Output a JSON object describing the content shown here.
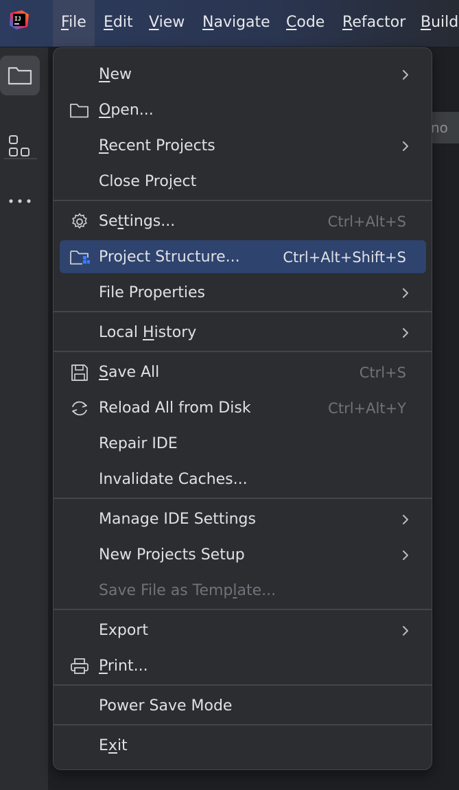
{
  "menubar": {
    "items": [
      {
        "pre": "",
        "u": "F",
        "post": "ile"
      },
      {
        "pre": "",
        "u": "E",
        "post": "dit"
      },
      {
        "pre": "",
        "u": "V",
        "post": "iew"
      },
      {
        "pre": "",
        "u": "N",
        "post": "avigate"
      },
      {
        "pre": "",
        "u": "C",
        "post": "ode"
      },
      {
        "pre": "",
        "u": "R",
        "post": "efactor"
      },
      {
        "pre": "",
        "u": "B",
        "post": "uild"
      }
    ]
  },
  "logo": {
    "text": "IJ"
  },
  "toolstrip": {
    "icons": [
      "project-folder-icon",
      "structure-icon",
      "more-icon"
    ]
  },
  "peek_tab": {
    "text": "no"
  },
  "dropdown": {
    "rows": [
      {
        "pre": "",
        "u": "N",
        "post": "ew",
        "shortcut": "",
        "submenu": true,
        "icon": ""
      },
      {
        "pre": "",
        "u": "O",
        "post": "pen...",
        "shortcut": "",
        "submenu": false,
        "icon": "folder-icon"
      },
      {
        "pre": "",
        "u": "R",
        "post": "ecent Projects",
        "shortcut": "",
        "submenu": true,
        "icon": ""
      },
      {
        "pre": "Close Pro",
        "u": "j",
        "post": "ect",
        "shortcut": "",
        "submenu": false,
        "icon": ""
      },
      {
        "pre": "Se",
        "u": "t",
        "post": "tings...",
        "shortcut": "Ctrl+Alt+S",
        "submenu": false,
        "icon": "gear-icon"
      },
      {
        "pre": "Project Structure...",
        "u": "",
        "post": "",
        "shortcut": "Ctrl+Alt+Shift+S",
        "submenu": false,
        "icon": "project-structure-icon",
        "selected": true
      },
      {
        "pre": "File Properties",
        "u": "",
        "post": "",
        "shortcut": "",
        "submenu": true,
        "icon": ""
      },
      {
        "pre": "Local ",
        "u": "H",
        "post": "istory",
        "shortcut": "",
        "submenu": true,
        "icon": ""
      },
      {
        "pre": "",
        "u": "S",
        "post": "ave All",
        "shortcut": "Ctrl+S",
        "submenu": false,
        "icon": "save-icon"
      },
      {
        "pre": "Reload All from Disk",
        "u": "",
        "post": "",
        "shortcut": "Ctrl+Alt+Y",
        "submenu": false,
        "icon": "reload-icon"
      },
      {
        "pre": "Repair IDE",
        "u": "",
        "post": "",
        "shortcut": "",
        "submenu": false,
        "icon": ""
      },
      {
        "pre": "Invalidate Caches...",
        "u": "",
        "post": "",
        "shortcut": "",
        "submenu": false,
        "icon": ""
      },
      {
        "pre": "Manage IDE Settings",
        "u": "",
        "post": "",
        "shortcut": "",
        "submenu": true,
        "icon": ""
      },
      {
        "pre": "New Projects Setup",
        "u": "",
        "post": "",
        "shortcut": "",
        "submenu": true,
        "icon": ""
      },
      {
        "pre": "Save File as Temp",
        "u": "l",
        "post": "ate...",
        "shortcut": "",
        "submenu": false,
        "icon": "",
        "disabled": true
      },
      {
        "pre": "Export",
        "u": "",
        "post": "",
        "shortcut": "",
        "submenu": true,
        "icon": ""
      },
      {
        "pre": "",
        "u": "P",
        "post": "rint...",
        "shortcut": "",
        "submenu": false,
        "icon": "print-icon"
      },
      {
        "pre": "Power Save Mode",
        "u": "",
        "post": "",
        "shortcut": "",
        "submenu": false,
        "icon": ""
      },
      {
        "pre": "E",
        "u": "x",
        "post": "it",
        "shortcut": "",
        "submenu": false,
        "icon": ""
      }
    ]
  },
  "colors": {
    "selection": "#2e436e",
    "menu_bg": "#2b2d30",
    "shortcut": "#70737a",
    "disabled": "#6f737a"
  }
}
